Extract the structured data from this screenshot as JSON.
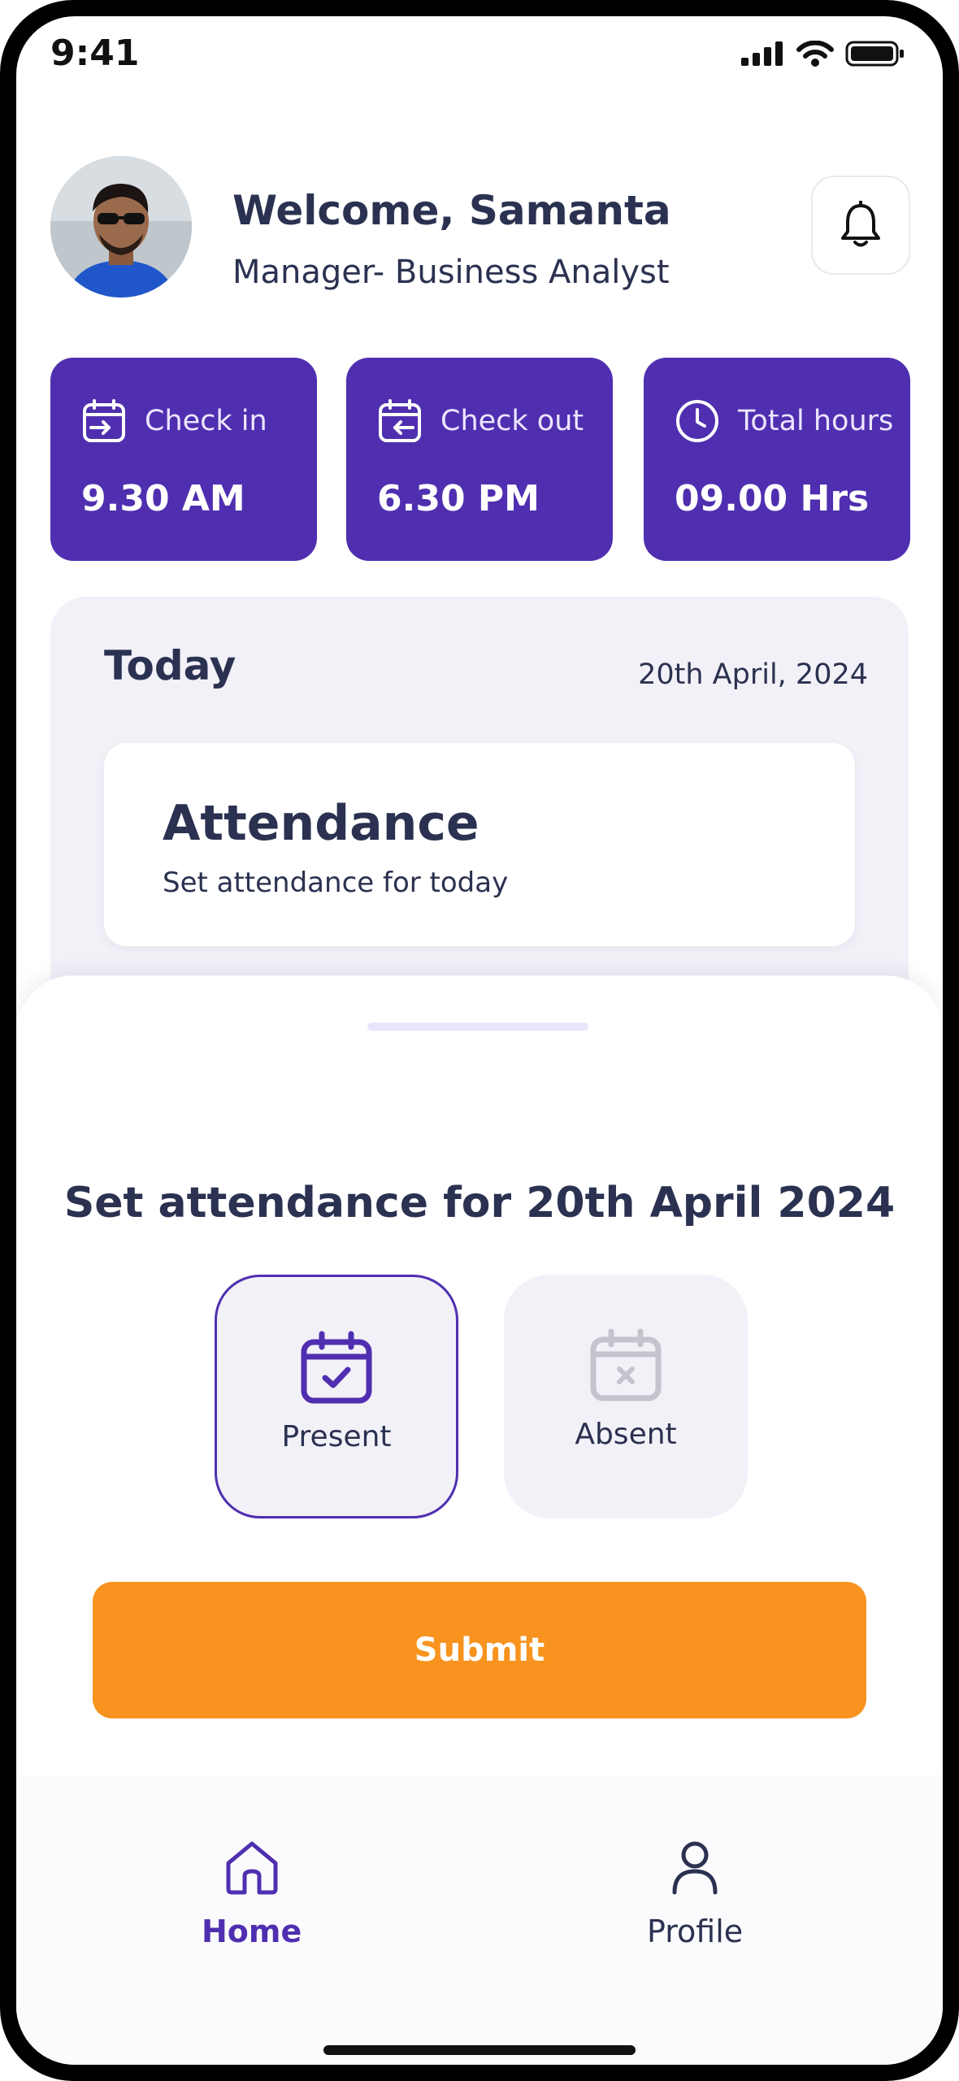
{
  "status_bar": {
    "time": "9:41"
  },
  "header": {
    "welcome": "Welcome, Samanta",
    "role": "Manager- Business Analyst"
  },
  "stats": [
    {
      "label": "Check in",
      "value": "9.30 AM",
      "icon": "calendar-checkin-icon"
    },
    {
      "label": "Check out",
      "value": "6.30 PM",
      "icon": "calendar-checkout-icon"
    },
    {
      "label": "Total hours",
      "value": "09.00 Hrs",
      "icon": "clock-icon"
    }
  ],
  "today": {
    "title": "Today",
    "date": "20th April, 2024",
    "card_title": "Attendance",
    "card_subtitle": "Set attendance for today"
  },
  "sheet": {
    "title": "Set attendance for 20th April 2024",
    "options": [
      {
        "label": "Present",
        "selected": true
      },
      {
        "label": "Absent",
        "selected": false
      }
    ],
    "submit_label": "Submit"
  },
  "nav": {
    "home": "Home",
    "profile": "Profile"
  },
  "colors": {
    "primary": "#4f2fb0",
    "accent": "#f7931e",
    "text": "#2b3150",
    "panel": "#f2f1f8"
  }
}
